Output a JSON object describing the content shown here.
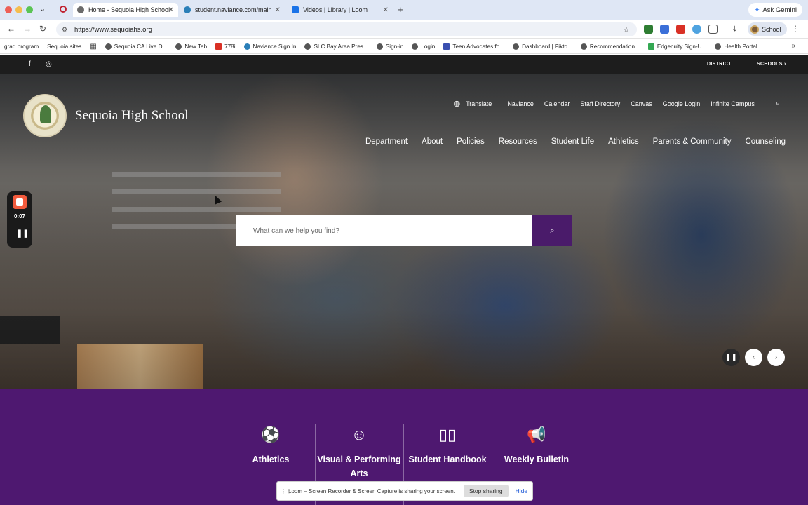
{
  "browser": {
    "tabs": [
      {
        "label": "Home - Sequoia High School",
        "active": true,
        "favicon_color": "#6b6b6b"
      },
      {
        "label": "student.naviance.com/main",
        "active": false,
        "favicon_color": "#2a7fb8"
      },
      {
        "label": "Videos | Library | Loom",
        "active": false,
        "favicon_color": "#1a73e8"
      }
    ],
    "ask_gemini": "Ask Gemini",
    "url": "https://www.sequoiahs.org",
    "profile_label": "School",
    "bookmarks": [
      "grad program",
      "Sequoia sites",
      "Sequoia CA Live D...",
      "New Tab",
      "778i",
      "Naviance Sign In",
      "SLC Bay Area Pres...",
      "Sign-in",
      "Login",
      "Teen Advocates fo...",
      "Dashboard | Pikto...",
      "Recommendation...",
      "Edgenuity Sign-U...",
      "Health Portal"
    ]
  },
  "site": {
    "utility": {
      "district": "DISTRICT",
      "schools": "SCHOOLS ›"
    },
    "school_name": "Sequoia High School",
    "top_links": [
      "Translate",
      "Naviance",
      "Calendar",
      "Staff Directory",
      "Canvas",
      "Google Login",
      "Infinite Campus"
    ],
    "main_nav": [
      "Department",
      "About",
      "Policies",
      "Resources",
      "Student Life",
      "Athletics",
      "Parents & Community",
      "Counseling"
    ],
    "search_placeholder": "What can we help you find?",
    "quick_links": [
      {
        "label": "Athletics",
        "icon": "football-icon"
      },
      {
        "label": "Visual & Performing Arts",
        "icon": "theater-masks-icon"
      },
      {
        "label": "Student Handbook",
        "icon": "book-icon"
      },
      {
        "label": "Weekly Bulletin",
        "icon": "megaphone-icon"
      }
    ]
  },
  "loom": {
    "timer": "0:07",
    "share_message": "Loom – Screen Recorder & Screen Capture is sharing your screen.",
    "stop_label": "Stop sharing",
    "hide_label": "Hide"
  },
  "colors": {
    "brand_purple": "#4e1870",
    "search_button": "#4a1b6a",
    "loom_record": "#f25a3c"
  }
}
